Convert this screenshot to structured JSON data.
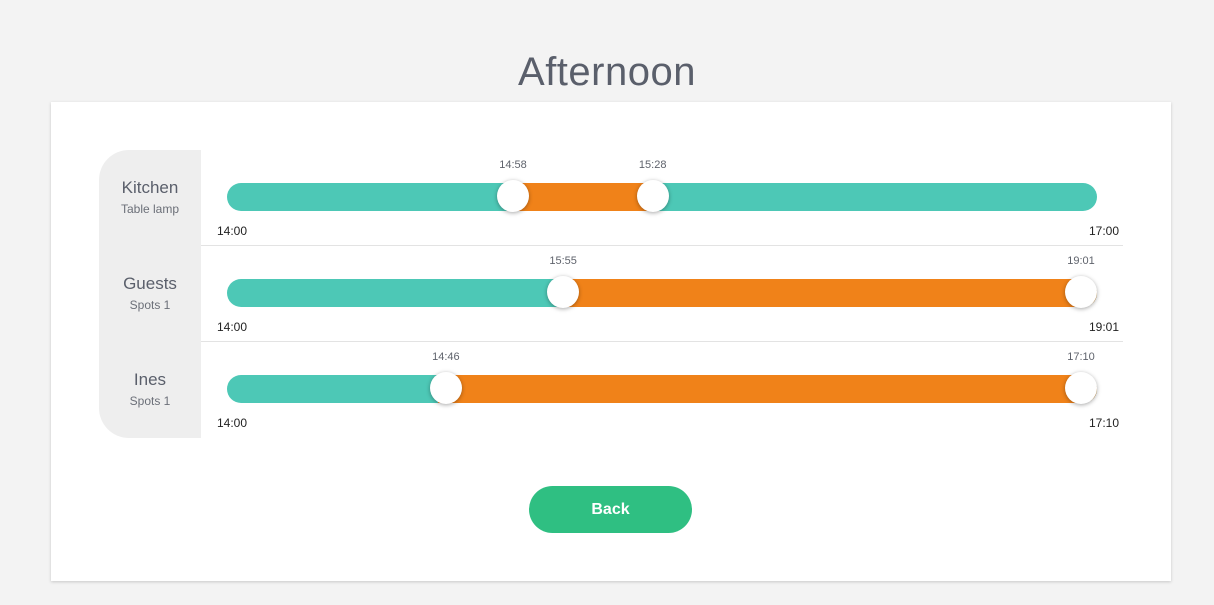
{
  "title": "Afternoon",
  "rows": [
    {
      "name": "Kitchen",
      "device": "Table lamp",
      "range_min": "14:00",
      "range_max": "17:00",
      "range_min_minutes": 840,
      "range_max_minutes": 1020,
      "start": "14:58",
      "end": "15:28",
      "start_minutes": 898,
      "end_minutes": 928,
      "start_label": "14:58",
      "end_label": "15:28"
    },
    {
      "name": "Guests",
      "device": "Spots 1",
      "range_min": "14:00",
      "range_max": "19:01",
      "range_min_minutes": 840,
      "range_max_minutes": 1141,
      "start": "15:55",
      "end": "19:01",
      "start_minutes": 955,
      "end_minutes": 1141,
      "start_label": "15:55",
      "end_label": "19:01"
    },
    {
      "name": "Ines",
      "device": "Spots 1",
      "range_min": "14:00",
      "range_max": "17:10",
      "range_min_minutes": 840,
      "range_max_minutes": 1030,
      "start": "14:46",
      "end": "17:10",
      "start_minutes": 886,
      "end_minutes": 1030,
      "start_label": "14:46",
      "end_label": "17:10"
    }
  ],
  "back_label": "Back",
  "colors": {
    "track": "#4dc8b6",
    "active_range": "#f08219",
    "button": "#2fbf82",
    "background": "#f3f3f3"
  }
}
